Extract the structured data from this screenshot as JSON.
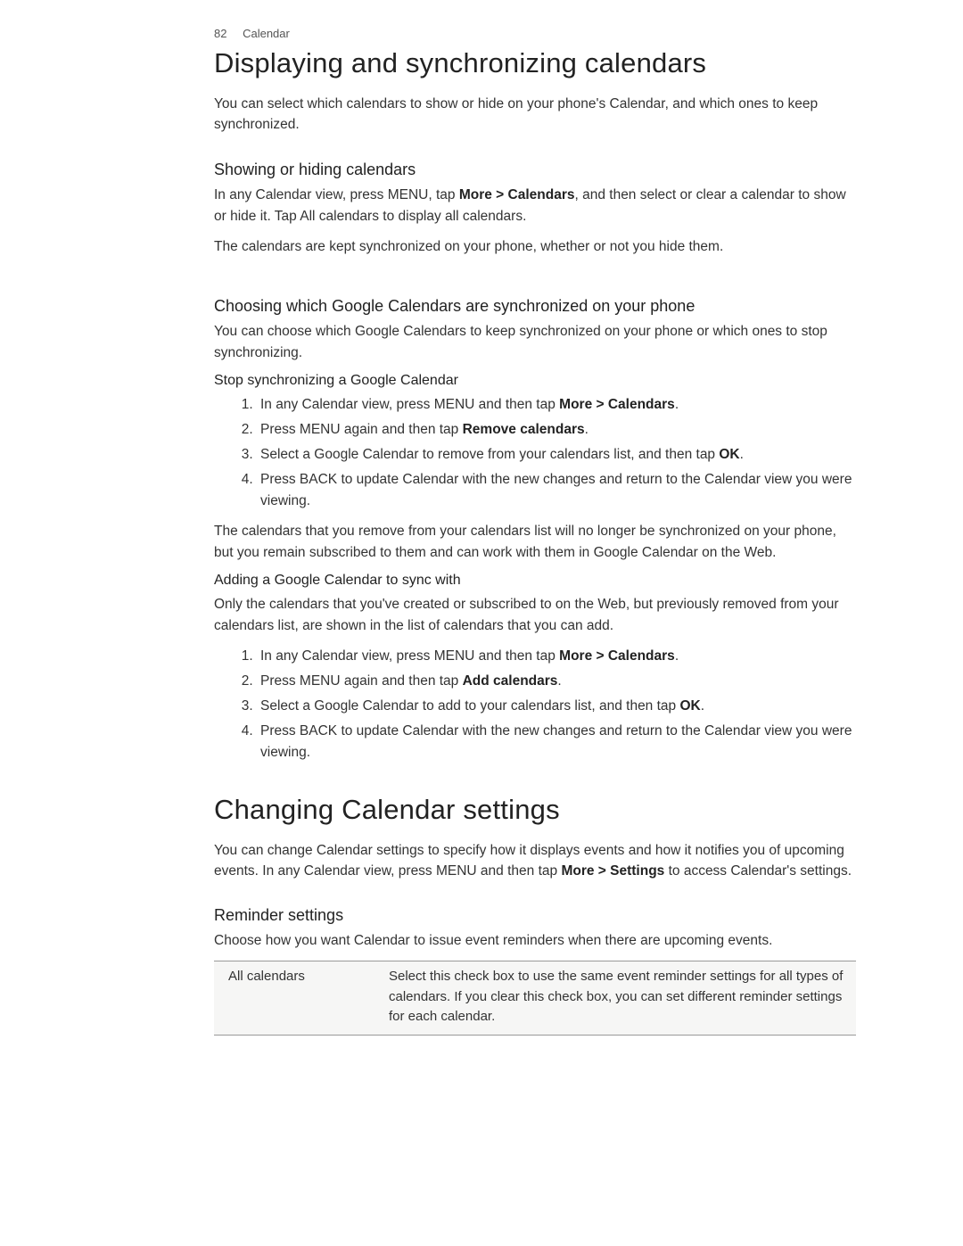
{
  "header": {
    "page_num": "82",
    "section": "Calendar"
  },
  "h1_a": "Displaying and synchronizing calendars",
  "intro_a": "You can select which calendars to show or hide on your phone's Calendar, and which ones to keep synchronized.",
  "sec1": {
    "title": "Showing or hiding calendars",
    "p1_pre": "In any Calendar view, press MENU, tap ",
    "p1_bold": "More > Calendars",
    "p1_post": ", and then select or clear a calendar to show or hide it. Tap All calendars to display all calendars.",
    "p2": "The calendars are kept synchronized on your phone, whether or not you hide them."
  },
  "sec2": {
    "title": "Choosing which Google Calendars are synchronized on your phone",
    "p1": "You can choose which Google Calendars to keep synchronized on your phone or which ones to stop synchronizing.",
    "sub1": {
      "title": "Stop synchronizing a Google Calendar",
      "steps": {
        "s1_pre": "In any Calendar view, press MENU and then tap ",
        "s1_bold": "More > Calendars",
        "s1_post": ".",
        "s2_pre": "Press MENU again and then tap ",
        "s2_bold": "Remove calendars",
        "s2_post": ".",
        "s3_pre": "Select a Google Calendar to remove from your calendars list, and then tap ",
        "s3_bold": "OK",
        "s3_post": ".",
        "s4": "Press BACK to update Calendar with the new changes and return to the Calendar view you were viewing."
      },
      "after": "The calendars that you remove from your calendars list will no longer be synchronized on your phone, but you remain subscribed to them and can work with them in Google Calendar on the Web."
    },
    "sub2": {
      "title": "Adding a Google Calendar to sync with",
      "p1": "Only the calendars that you've created or subscribed to on the Web, but previously removed from your calendars list, are shown in the list of calendars that you can add.",
      "steps": {
        "s1_pre": "In any Calendar view, press MENU and then tap ",
        "s1_bold": "More > Calendars",
        "s1_post": ".",
        "s2_pre": "Press MENU again and then tap ",
        "s2_bold": "Add calendars",
        "s2_post": ".",
        "s3_pre": "Select a Google Calendar to add to your calendars list, and then tap ",
        "s3_bold": "OK",
        "s3_post": ".",
        "s4": "Press BACK to update Calendar with the new changes and return to the Calendar view you were viewing."
      }
    }
  },
  "h1_b": "Changing Calendar settings",
  "intro_b_pre": "You can change Calendar settings to specify how it displays events and how it notifies you of upcoming events. In any Calendar view, press MENU and then tap ",
  "intro_b_bold": "More > Settings",
  "intro_b_post": " to access Calendar's settings.",
  "sec3": {
    "title": "Reminder settings",
    "p1": "Choose how you want Calendar to issue event reminders when there are upcoming events.",
    "table": {
      "row1": {
        "label": "All calendars",
        "desc": "Select this check box to use the same event reminder settings for all types of calendars. If you clear this check box, you can set different reminder settings for each calendar."
      }
    }
  }
}
